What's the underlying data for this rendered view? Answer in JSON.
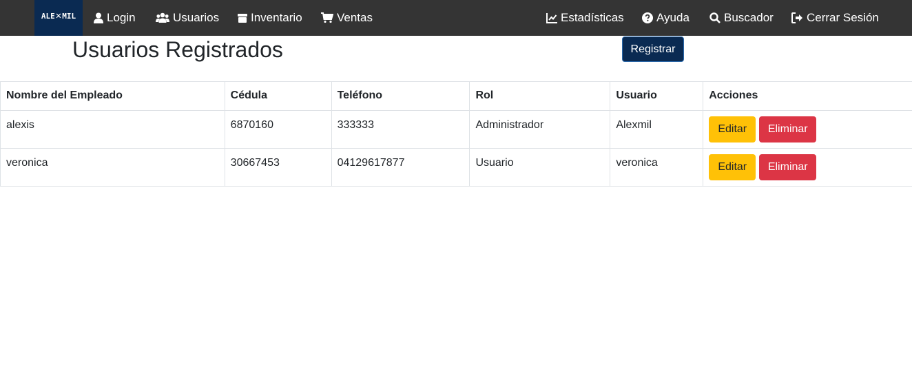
{
  "brand": {
    "left": "ALE",
    "mark": "✕",
    "right": "MIL"
  },
  "nav": {
    "login": "Login",
    "usuarios": "Usuarios",
    "inventario": "Inventario",
    "ventas": "Ventas",
    "estadisticas": "Estadísticas",
    "ayuda": "Ayuda",
    "buscador": "Buscador",
    "cerrar_sesion": "Cerrar Sesión"
  },
  "page": {
    "title": "Usuarios Registrados",
    "register_label": "Registrar"
  },
  "table": {
    "headers": [
      "Nombre del Empleado",
      "Cédula",
      "Teléfono",
      "Rol",
      "Usuario",
      "Acciones"
    ],
    "rows": [
      {
        "nombre": "alexis",
        "cedula": "6870160",
        "telefono": "333333",
        "rol": "Administrador",
        "usuario": "Alexmil",
        "edit_label": "Editar",
        "delete_label": "Eliminar"
      },
      {
        "nombre": "veronica",
        "cedula": "30667453",
        "telefono": "04129617877",
        "rol": "Usuario",
        "usuario": "veronica",
        "edit_label": "Editar",
        "delete_label": "Eliminar"
      }
    ]
  },
  "colors": {
    "navbar": "#343434",
    "brand": "#0a2a52",
    "edit": "#ffc107",
    "delete": "#dc3545"
  }
}
